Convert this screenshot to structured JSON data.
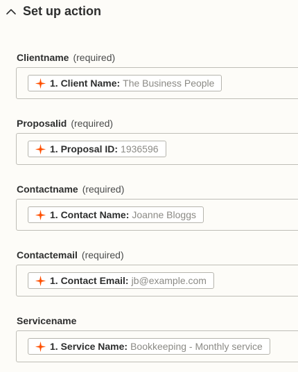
{
  "section": {
    "title": "Set up action",
    "collapse_icon": "chevron-up-icon"
  },
  "fields": [
    {
      "name": "Clientname",
      "required_text": "(required)",
      "token": {
        "icon": "zapier-spark-icon",
        "label": "1. Client Name:",
        "value": "The Business People"
      },
      "accent_color": "#ff4f00"
    },
    {
      "name": "Proposalid",
      "required_text": "(required)",
      "token": {
        "icon": "zapier-spark-icon",
        "label": "1. Proposal ID:",
        "value": "1936596"
      },
      "accent_color": "#ff4f00"
    },
    {
      "name": "Contactname",
      "required_text": "(required)",
      "token": {
        "icon": "zapier-spark-icon",
        "label": "1. Contact Name:",
        "value": "Joanne Bloggs"
      },
      "accent_color": "#ff4f00"
    },
    {
      "name": "Contactemail",
      "required_text": "(required)",
      "token": {
        "icon": "zapier-spark-icon",
        "label": "1. Contact Email:",
        "value": "jb@example.com"
      },
      "accent_color": "#ff4f00"
    },
    {
      "name": "Servicename",
      "required_text": "",
      "token": {
        "icon": "zapier-spark-icon",
        "label": "1. Service Name:",
        "value": "Bookkeeping - Monthly service"
      },
      "accent_color": "#ff4f00"
    }
  ]
}
